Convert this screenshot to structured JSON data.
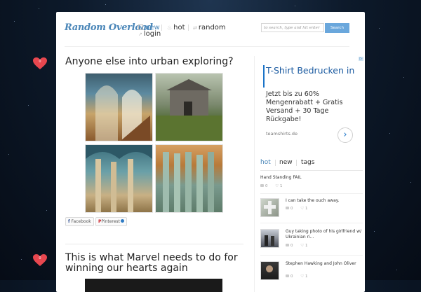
{
  "site": {
    "logo": "Random Overload"
  },
  "nav": {
    "new": "new",
    "hot": "hot",
    "random": "random",
    "login": "login"
  },
  "search": {
    "placeholder": "to search, type and hit enter",
    "button": "Search"
  },
  "posts": [
    {
      "title": "Anyone else into urban exploring?",
      "likes": "0",
      "share": {
        "facebook": "Facebook",
        "pinterest": "Pinterest"
      }
    },
    {
      "title": "This is what Marvel needs to do for winning our hearts again",
      "likes": "0"
    }
  ],
  "ad": {
    "marker": "▷",
    "title": "T-Shirt Bedrucken in",
    "text": "Jetzt bis zu 60% Mengenrabatt + Gratis Versand + 30 Tage Rückgabe!",
    "url": "teamshirts.de"
  },
  "sidebar": {
    "tabs": [
      "hot",
      "new",
      "tags"
    ],
    "items": [
      {
        "title": "Hand Standing FAIL",
        "comments": "0",
        "likes": "1"
      },
      {
        "title": "I can take the ouch away.",
        "comments": "0",
        "likes": "1"
      },
      {
        "title": "Guy taking photo of his girlfriend w/ Ukrainian ri...",
        "comments": "0",
        "likes": "1"
      },
      {
        "title": "Stephen Hawking and John Oliver",
        "comments": "0",
        "likes": "1"
      }
    ]
  },
  "colors": {
    "accent": "#4a86b8",
    "heart": "#e8474f",
    "ad_link": "#1a5aa0"
  }
}
